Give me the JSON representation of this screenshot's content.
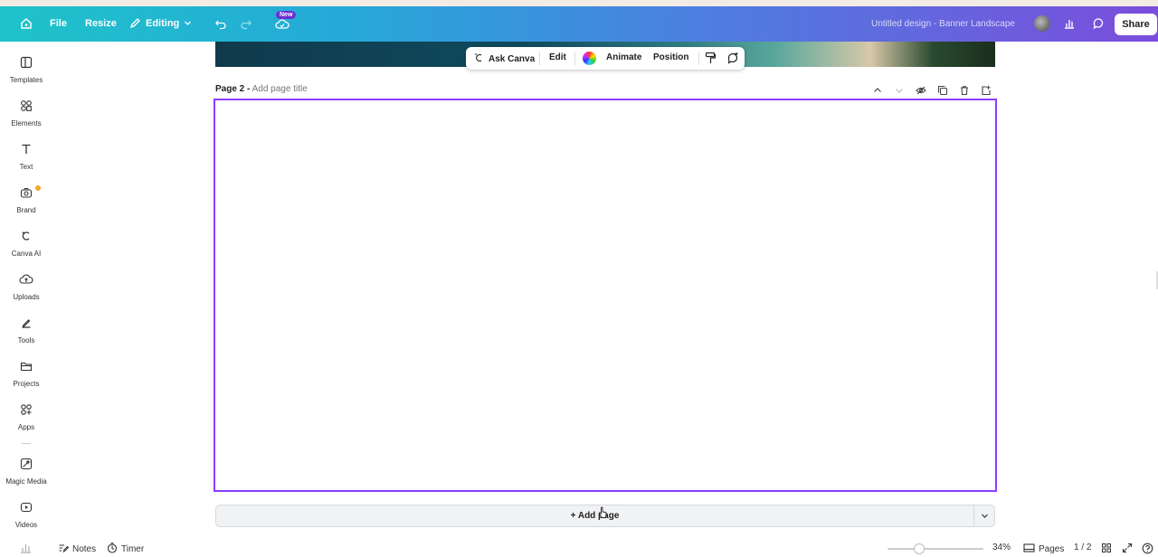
{
  "topbar": {
    "file": "File",
    "resize": "Resize",
    "editing": "Editing",
    "new_badge": "New",
    "design_title": "Untitled design - Banner Landscape",
    "share": "Share"
  },
  "sidebar": {
    "items": [
      {
        "label": "Templates",
        "icon": "templates-icon"
      },
      {
        "label": "Elements",
        "icon": "elements-icon"
      },
      {
        "label": "Text",
        "icon": "text-icon"
      },
      {
        "label": "Brand",
        "icon": "brand-icon"
      },
      {
        "label": "Canva AI",
        "icon": "canva-ai-icon"
      },
      {
        "label": "Uploads",
        "icon": "uploads-icon"
      },
      {
        "label": "Tools",
        "icon": "tools-icon"
      },
      {
        "label": "Projects",
        "icon": "projects-icon"
      },
      {
        "label": "Apps",
        "icon": "apps-icon"
      },
      {
        "label": "Magic Media",
        "icon": "magic-media-icon"
      },
      {
        "label": "Videos",
        "icon": "videos-icon"
      }
    ]
  },
  "context_toolbar": {
    "ask_canva": "Ask Canva",
    "edit": "Edit",
    "animate": "Animate",
    "position": "Position"
  },
  "page": {
    "label": "Page 2 -",
    "title_placeholder": "Add page title"
  },
  "add_page": "+ Add page",
  "bottombar": {
    "notes": "Notes",
    "timer": "Timer",
    "zoom": "34%",
    "zoom_level": 0.34,
    "pages": "Pages",
    "page_count": "1 / 2"
  },
  "colors": {
    "accent": "#8b3dff",
    "gradient_start": "#1fc3c9",
    "gradient_end": "#7b4ddc"
  }
}
